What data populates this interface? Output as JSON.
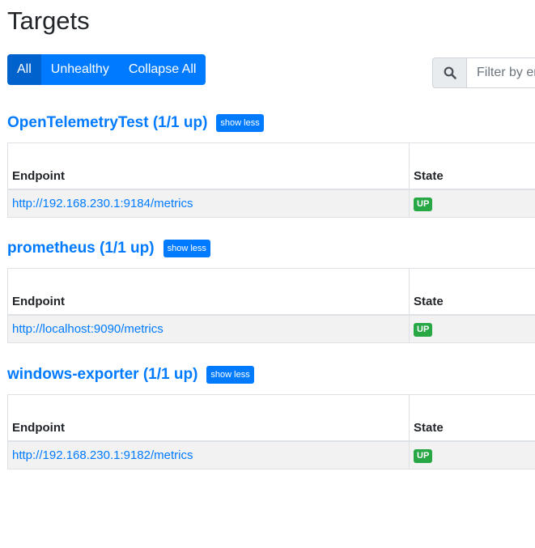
{
  "page": {
    "title": "Targets"
  },
  "toolbar": {
    "buttons": [
      {
        "label": "All"
      },
      {
        "label": "Unhealthy"
      },
      {
        "label": "Collapse All"
      }
    ],
    "filter_placeholder": "Filter by endpoint or labels",
    "icon": "search-icon"
  },
  "pools": [
    {
      "title": "OpenTelemetryTest (1/1 up)",
      "toggle_label": "show less",
      "headers": [
        "Endpoint",
        "State"
      ],
      "rows": [
        {
          "endpoint": "http://192.168.230.1:9184/metrics",
          "state": "UP"
        }
      ]
    },
    {
      "title": "prometheus (1/1 up)",
      "toggle_label": "show less",
      "headers": [
        "Endpoint",
        "State"
      ],
      "rows": [
        {
          "endpoint": "http://localhost:9090/metrics",
          "state": "UP"
        }
      ]
    },
    {
      "title": "windows-exporter (1/1 up)",
      "toggle_label": "show less",
      "headers": [
        "Endpoint",
        "State"
      ],
      "rows": [
        {
          "endpoint": "http://192.168.230.1:9182/metrics",
          "state": "UP"
        }
      ]
    }
  ],
  "colors": {
    "primary": "#007bff",
    "primary_active": "#0062cc",
    "up_badge": "#28a745"
  }
}
